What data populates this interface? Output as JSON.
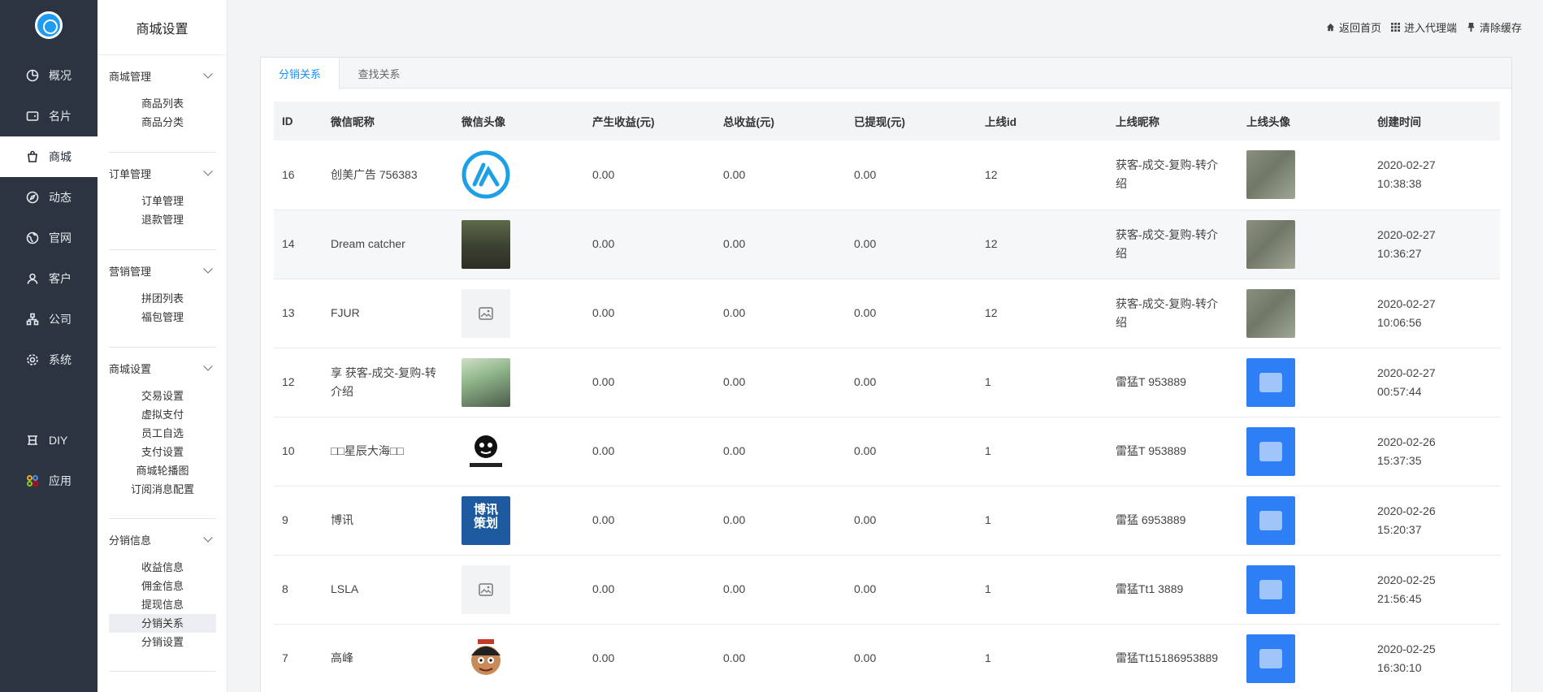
{
  "rail": {
    "items": [
      {
        "label": "概况",
        "icon": "pie-chart-icon"
      },
      {
        "label": "名片",
        "icon": "card-icon"
      },
      {
        "label": "商城",
        "icon": "shopping-bag-icon"
      },
      {
        "label": "动态",
        "icon": "compass-icon"
      },
      {
        "label": "官网",
        "icon": "globe-icon"
      },
      {
        "label": "客户",
        "icon": "user-icon"
      },
      {
        "label": "公司",
        "icon": "org-icon"
      },
      {
        "label": "系统",
        "icon": "gear-icon"
      },
      {
        "label": "DIY",
        "icon": "diy-icon"
      },
      {
        "label": "应用",
        "icon": "apps-icon"
      }
    ]
  },
  "sidebar": {
    "title": "商城设置",
    "groups": [
      {
        "title": "商城管理",
        "items": [
          "商品列表",
          "商品分类"
        ]
      },
      {
        "title": "订单管理",
        "items": [
          "订单管理",
          "退款管理"
        ]
      },
      {
        "title": "营销管理",
        "items": [
          "拼团列表",
          "福包管理"
        ]
      },
      {
        "title": "商城设置",
        "items": [
          "交易设置",
          "虚拟支付",
          "员工自选",
          "支付设置",
          "商城轮播图",
          "订阅消息配置"
        ]
      },
      {
        "title": "分销信息",
        "items": [
          "收益信息",
          "佣金信息",
          "提现信息",
          "分销关系",
          "分销设置"
        ]
      }
    ],
    "active_item": "分销关系"
  },
  "toplinks": {
    "home": "返回首页",
    "agent": "进入代理端",
    "cache": "清除缓存"
  },
  "tabs": [
    "分销关系",
    "查找关系"
  ],
  "active_tab": "分销关系",
  "table": {
    "headers": [
      "ID",
      "微信昵称",
      "微信头像",
      "产生收益(元)",
      "总收益(元)",
      "已提现(元)",
      "上线id",
      "上线昵称",
      "上线头像",
      "创建时间"
    ],
    "rows": [
      {
        "id": "16",
        "nick": "创美广告      756383",
        "income": "0.00",
        "total": "0.00",
        "withdrawn": "0.00",
        "pid": "12",
        "pnick": "        获客-成交-复购-转介绍",
        "date": "2020-02-27",
        "time": "10:38:38"
      },
      {
        "id": "14",
        "nick": "Dream catcher",
        "income": "0.00",
        "total": "0.00",
        "withdrawn": "0.00",
        "pid": "12",
        "pnick": "        获客-成交-复购-转介绍",
        "date": "2020-02-27",
        "time": "10:36:27"
      },
      {
        "id": "13",
        "nick": "FJUR",
        "income": "0.00",
        "total": "0.00",
        "withdrawn": "0.00",
        "pid": "12",
        "pnick": "        获客-成交-复购-转介绍",
        "date": "2020-02-27",
        "time": "10:06:56"
      },
      {
        "id": "12",
        "nick": "        享 获客-成交-复购-转介绍",
        "income": "0.00",
        "total": "0.00",
        "withdrawn": "0.00",
        "pid": "1",
        "pnick": "雷猛T      953889",
        "date": "2020-02-27",
        "time": "00:57:44"
      },
      {
        "id": "10",
        "nick": "□□星辰大海□□",
        "income": "0.00",
        "total": "0.00",
        "withdrawn": "0.00",
        "pid": "1",
        "pnick": "雷猛T      953889",
        "date": "2020-02-26",
        "time": "15:37:35"
      },
      {
        "id": "9",
        "nick": "博讯",
        "income": "0.00",
        "total": "0.00",
        "withdrawn": "0.00",
        "pid": "1",
        "pnick": "雷猛      6953889",
        "date": "2020-02-26",
        "time": "15:20:37"
      },
      {
        "id": "8",
        "nick": "LSLA",
        "income": "0.00",
        "total": "0.00",
        "withdrawn": "0.00",
        "pid": "1",
        "pnick": "雷猛Tt1     3889",
        "date": "2020-02-25",
        "time": "21:56:45"
      },
      {
        "id": "7",
        "nick": "高峰",
        "income": "0.00",
        "total": "0.00",
        "withdrawn": "0.00",
        "pid": "1",
        "pnick": "雷猛Tt15186953889",
        "date": "2020-02-25",
        "time": "16:30:10"
      }
    ]
  },
  "avatar_text": {
    "book": "博讯\n策划"
  }
}
